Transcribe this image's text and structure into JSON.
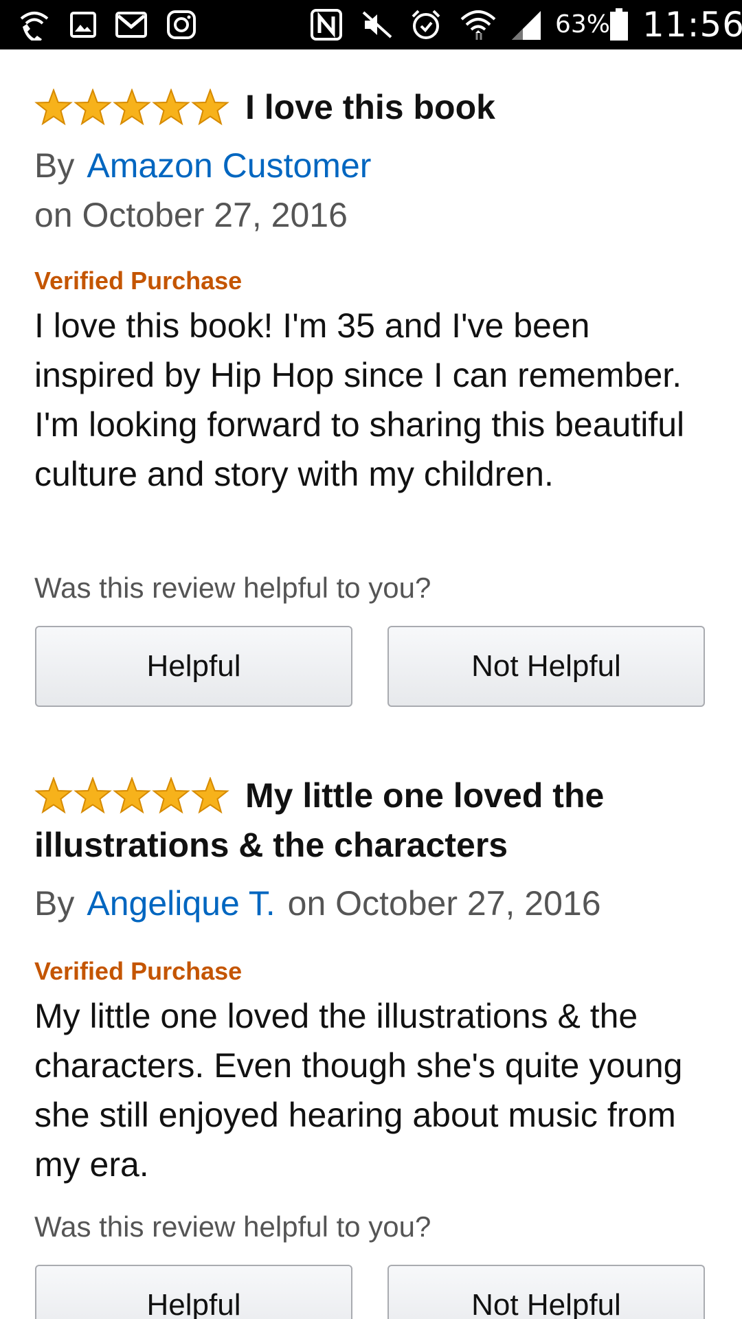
{
  "status_bar": {
    "battery_percent": "63%",
    "time": "11:56",
    "icons": [
      "wifi-calling-icon",
      "gallery-icon",
      "gmail-icon",
      "instagram-icon",
      "nfc-icon",
      "mute-icon",
      "alarm-icon",
      "wifi-icon",
      "signal-icon",
      "battery-icon"
    ]
  },
  "reviews": [
    {
      "rating": 5,
      "title": "I love this book",
      "by_label": "By",
      "author": "Amazon Customer",
      "date": "on October 27, 2016",
      "verified": "Verified Purchase",
      "body": "I love this book! I'm 35 and I've been inspired by Hip Hop since I can remember. I'm looking forward to sharing this beautiful culture and story with my children.",
      "helpful_question": "Was this review helpful to you?",
      "helpful_label": "Helpful",
      "not_helpful_label": "Not Helpful"
    },
    {
      "rating": 5,
      "title": "My little one loved the illustrations & the characters",
      "by_label": "By",
      "author": "Angelique T.",
      "date": "on October 27, 2016",
      "verified": "Verified Purchase",
      "body": "My little one loved the illustrations & the characters. Even though she's quite young she still enjoyed hearing about music from my era.",
      "helpful_question": "Was this review helpful to you?",
      "helpful_label": "Helpful",
      "not_helpful_label": "Not Helpful"
    }
  ],
  "colors": {
    "star_fill": "#f7b21b",
    "star_stroke": "#d68a00",
    "author_link": "#0066c0",
    "verified": "#c45500"
  }
}
